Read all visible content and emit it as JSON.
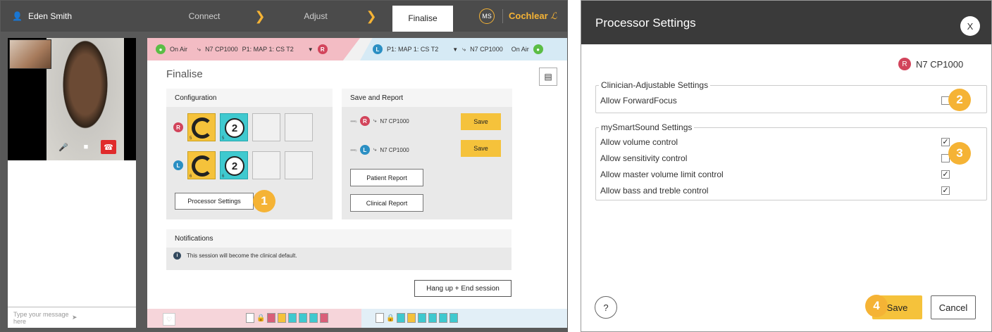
{
  "left_app": {
    "user_name": "Eden Smith",
    "steps": [
      "Connect",
      "Adjust",
      "Finalise"
    ],
    "active_step": "Finalise",
    "user_initials": "MS",
    "brand": "Cochlear",
    "chat_placeholder": "Type your message here",
    "status_strip": {
      "right": {
        "on_air": "On Air",
        "device": "N7 CP1000",
        "map": "P1: MAP 1: CS T2",
        "side": "R"
      },
      "left": {
        "side": "L",
        "map": "P1: MAP 1: CS T2",
        "device": "N7 CP1000",
        "on_air": "On Air"
      }
    },
    "page_title": "Finalise",
    "configuration": {
      "title": "Configuration",
      "rows": [
        {
          "side": "R",
          "tile1_sub": "5",
          "tile2_number": "2",
          "tile2_sub": "5"
        },
        {
          "side": "L",
          "tile1_sub": "6",
          "tile2_number": "2",
          "tile2_sub": "6"
        }
      ],
      "processor_settings_label": "Processor Settings",
      "callout": "1"
    },
    "save_and_report": {
      "title": "Save and Report",
      "devices": [
        {
          "side": "R",
          "name": "N7 CP1000",
          "save_label": "Save"
        },
        {
          "side": "L",
          "name": "N7 CP1000",
          "save_label": "Save"
        }
      ],
      "patient_report_label": "Patient Report",
      "clinical_report_label": "Clinical Report"
    },
    "notifications": {
      "title": "Notifications",
      "message": "This session will become the clinical default."
    },
    "hang_up_label": "Hang up + End session"
  },
  "dialog": {
    "title": "Processor Settings",
    "close_label": "X",
    "device_side": "R",
    "device_name": "N7 CP1000",
    "clinician_group": {
      "title": "Clinician-Adjustable Settings",
      "items": [
        {
          "label": "Allow ForwardFocus",
          "checked": false
        }
      ],
      "callout": "2"
    },
    "smartsound_group": {
      "title": "mySmartSound Settings",
      "items": [
        {
          "label": "Allow volume control",
          "checked": true
        },
        {
          "label": "Allow sensitivity control",
          "checked": false
        },
        {
          "label": "Allow master volume limit control",
          "checked": true
        },
        {
          "label": "Allow bass and treble control",
          "checked": true
        }
      ],
      "callout": "3"
    },
    "help_label": "?",
    "save_callout": "4",
    "save_label": "Save",
    "cancel_label": "Cancel"
  },
  "colors": {
    "accent_yellow": "#f5c23b",
    "brand_orange": "#f5b335",
    "right_red": "#d2445b",
    "left_blue": "#2b8fc3",
    "on_air_green": "#5bbd45"
  }
}
